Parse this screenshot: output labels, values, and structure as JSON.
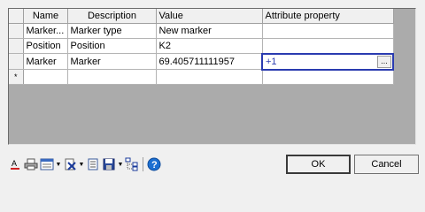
{
  "grid": {
    "columns": [
      "Name",
      "Description",
      "Value",
      "Attribute property"
    ],
    "rows": [
      {
        "header": "",
        "name": "Marker...",
        "description": "Marker type",
        "value": "New marker",
        "attribute": ""
      },
      {
        "header": "",
        "name": "Position",
        "description": "Position",
        "value": "K2",
        "attribute": ""
      },
      {
        "header": "",
        "name": "Marker",
        "description": "Marker",
        "value": "69.405711111957",
        "attribute": "+1"
      },
      {
        "header": "*",
        "name": "",
        "description": "",
        "value": "",
        "attribute": ""
      }
    ],
    "ellipsis_label": "..."
  },
  "toolbar": {
    "icons": [
      "text-color-icon",
      "print-icon",
      "view-icon",
      "delete-icon",
      "document-icon",
      "save-icon",
      "tree-icon",
      "help-icon"
    ]
  },
  "buttons": {
    "ok_label": "OK",
    "cancel_label": "Cancel"
  },
  "colors": {
    "accent": "#2a3bb0",
    "help": "#1b6fd1"
  }
}
